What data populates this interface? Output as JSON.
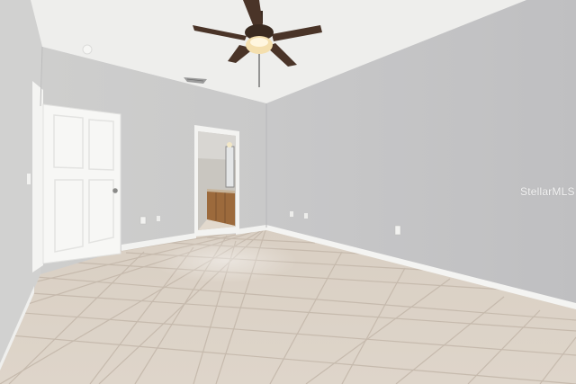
{
  "photo": {
    "subject": "empty-bedroom",
    "watermark_text": "StellarMLS",
    "colors": {
      "ceiling": "#eeeeec",
      "wall_left": "#d1d1d0",
      "wall_back": "#cacaca",
      "wall_right": "#c5c5c6",
      "baseboard": "#f4f4f2",
      "floor_tile": "#dcd2c6",
      "grout": "#c4b8aa",
      "door": "#f7f7f5",
      "fan_wood": "#4a3428"
    }
  }
}
